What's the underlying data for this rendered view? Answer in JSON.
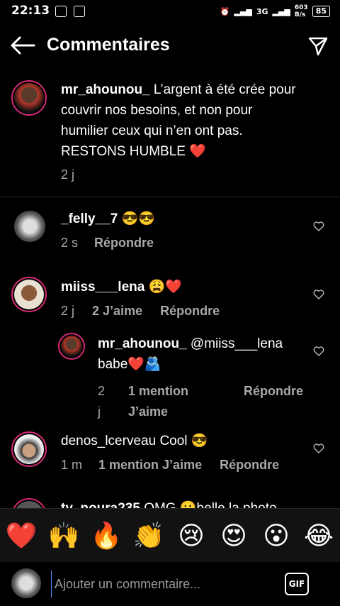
{
  "status": {
    "time": "22:13",
    "battery": "85",
    "network": "3G",
    "speed_top": "603",
    "speed_bottom": "B/s"
  },
  "header": {
    "title": "Commentaires"
  },
  "caption": {
    "username": "mr_ahounou_",
    "text": "L’argent à été crée pour couvrir nos besoins, et non pour humilier ceux qui n’en ont pas. RESTONS HUMBLE ❤️",
    "time": "2 j"
  },
  "comments": [
    {
      "username": "_felly__7",
      "text": "😎😎",
      "time": "2 s",
      "reply": "Répondre"
    },
    {
      "username": "miiss___lena",
      "text": "😩❤️",
      "time": "2 j",
      "likes": "2 J’aime",
      "reply": "Répondre"
    },
    {
      "username": "mr_ahounou_",
      "text": "@miiss___lena babe❤️🫂",
      "time": "2 j",
      "likes": "1 mention J’aime",
      "reply": "Répondre"
    },
    {
      "username": "denos_lcerveau",
      "text": "Cool 😎",
      "time": "1 m",
      "likes": "1 mention J’aime",
      "reply": "Répondre"
    },
    {
      "username": "ty_noura235",
      "text": "OMG 😮belle la photo"
    }
  ],
  "emojis": [
    "❤️",
    "🙌",
    "🔥",
    "👏",
    "😢",
    "😍",
    "😮",
    "😂"
  ],
  "input": {
    "placeholder": "Ajouter un commentaire...",
    "gif": "GIF"
  }
}
